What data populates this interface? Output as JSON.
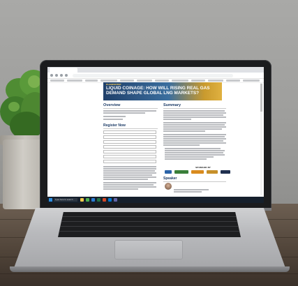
{
  "scene": {
    "description_free": true,
    "colors": {
      "wall": "#a9a9a7",
      "desk": "#5a4c40",
      "plant": "#3f7a2a",
      "laptop_lid": "#1b1c1e",
      "laptop_body": "#bfc0c3"
    }
  },
  "browser": {
    "tab_label": "",
    "url": ""
  },
  "webpage": {
    "banner": {
      "kicker": "PLANEXPERT",
      "title": "LIQUID COINAGE: HOW WILL RISING REAL GAS DEMAND SHAPE GLOBAL LNG MARKETS?",
      "subtitle": "",
      "badge": ""
    },
    "overview": {
      "heading": "Overview"
    },
    "summary": {
      "heading": "Summary"
    },
    "register": {
      "heading": "Register Now",
      "required_note": "",
      "fields": [
        "",
        "",
        "",
        "",
        "",
        "",
        ""
      ]
    },
    "sponsors": {
      "heading": "SPONSOR BY"
    },
    "speakers": {
      "heading": "Speaker",
      "name": "",
      "role": ""
    }
  },
  "taskbar": {
    "search_placeholder": "Type here to search",
    "time": "",
    "date": ""
  }
}
